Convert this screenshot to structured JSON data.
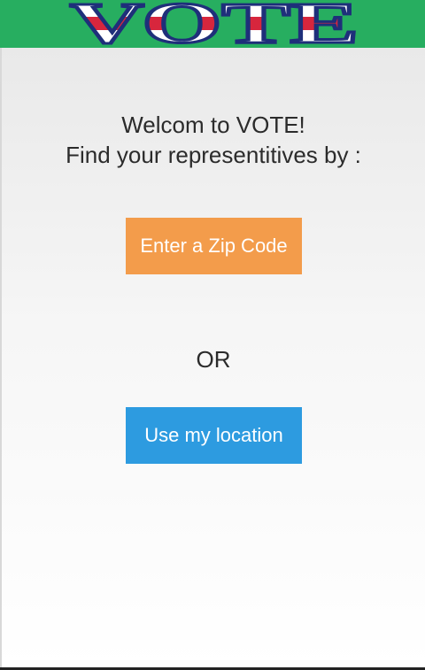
{
  "header": {
    "logo_text": "VOTE",
    "background_color": "#27ae60"
  },
  "main": {
    "welcome_line1": "Welcom to VOTE!",
    "welcome_line2": "Find your representitives by :",
    "zip_button_label": "Enter a Zip Code",
    "or_label": "OR",
    "location_button_label": "Use my location"
  },
  "colors": {
    "zip_button": "#f39c4b",
    "location_button": "#2d9be0",
    "text": "#2b2b2b"
  }
}
